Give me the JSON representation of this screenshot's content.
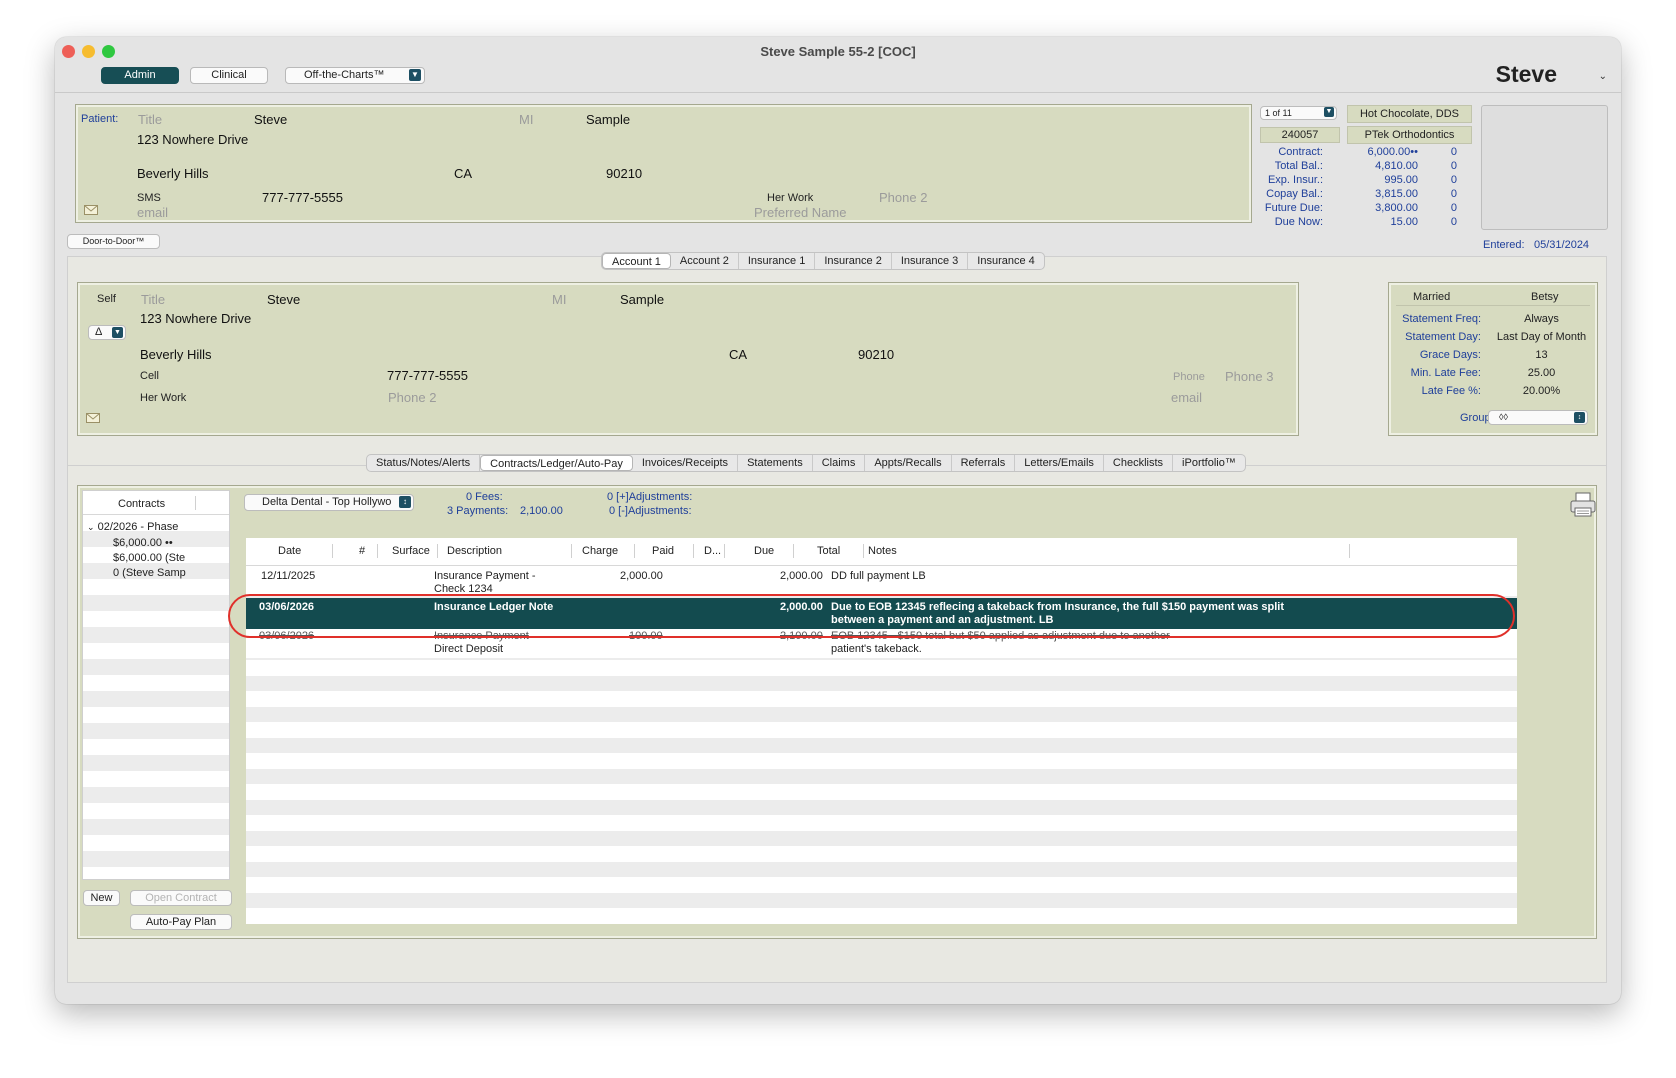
{
  "window": {
    "title": "Steve Sample 55-2 [COC]",
    "user_name": "Steve"
  },
  "toolbar": {
    "admin": "Admin",
    "clinical": "Clinical",
    "off_the_charts": "Off-the-Charts™"
  },
  "patient": {
    "label": "Patient:",
    "title_ph": "Title",
    "first": "Steve",
    "mi_ph": "MI",
    "last": "Sample",
    "address": "123 Nowhere Drive",
    "city": "Beverly Hills",
    "state": "CA",
    "zip": "90210",
    "sms_label": "SMS",
    "sms": "777-777-5555",
    "email_ph": "email",
    "work_label": "Her Work",
    "phone2_ph": "Phone 2",
    "preferred_ph": "Preferred Name",
    "door_button": "Door-to-Door™"
  },
  "summary": {
    "record_nav": "1 of 11",
    "doctor": "Hot Chocolate, DDS",
    "account_no": "240057",
    "practice": "PTek Orthodontics",
    "rows": [
      {
        "label": "Contract:",
        "value": "6,000.00••",
        "count": "0"
      },
      {
        "label": "Total Bal.:",
        "value": "4,810.00",
        "count": "0"
      },
      {
        "label": "Exp. Insur.:",
        "value": "995.00",
        "count": "0"
      },
      {
        "label": "Copay Bal.:",
        "value": "3,815.00",
        "count": "0"
      },
      {
        "label": "Future Due:",
        "value": "3,800.00",
        "count": "0"
      },
      {
        "label": "Due Now:",
        "value": "15.00",
        "count": "0"
      }
    ],
    "entered_label": "Entered:",
    "entered": "05/31/2024"
  },
  "account_tabs": [
    "Account 1",
    "Account 2",
    "Insurance 1",
    "Insurance 2",
    "Insurance 3",
    "Insurance 4"
  ],
  "account": {
    "relation": "Self",
    "title_ph": "Title",
    "first": "Steve",
    "mi_ph": "MI",
    "last": "Sample",
    "address": "123 Nowhere Drive",
    "delta": "Δ",
    "city": "Beverly Hills",
    "state": "CA",
    "zip": "90210",
    "cell_label": "Cell",
    "cell": "777-777-5555",
    "phone_label": "Phone",
    "phone3_ph": "Phone 3",
    "work_label": "Her Work",
    "phone2_ph": "Phone 2",
    "email_ph": "email"
  },
  "billing": {
    "status": "Married",
    "spouse": "Betsy",
    "rows": [
      {
        "label": "Statement Freq:",
        "value": "Always"
      },
      {
        "label": "Statement Day:",
        "value": "Last Day of Month"
      },
      {
        "label": "Grace Days:",
        "value": "13"
      },
      {
        "label": "Min. Late Fee:",
        "value": "25.00"
      },
      {
        "label": "Late Fee %:",
        "value": "20.00%"
      }
    ],
    "group_label": "Group:",
    "group_value": "◊◊"
  },
  "main_tabs": [
    "Status/Notes/Alerts",
    "Contracts/Ledger/Auto-Pay",
    "Invoices/Receipts",
    "Statements",
    "Claims",
    "Appts/Recalls",
    "Referrals",
    "Letters/Emails",
    "Checklists",
    "iPortfolio™"
  ],
  "contracts": {
    "header": "Contracts",
    "phase": "02/2026 - Phase",
    "items": [
      "$6,000.00 ••",
      "$6,000.00 (Ste",
      "0 (Steve Samp"
    ],
    "new_button": "New",
    "open_button": "Open Contract",
    "autopay_button": "Auto-Pay Plan"
  },
  "ledger": {
    "insurance_select": "Delta Dental - Top Hollywo",
    "fees": "0 Fees:",
    "payments": "3 Payments:",
    "payments_total": "2,100.00",
    "adj_plus": "0 [+]Adjustments:",
    "adj_minus": "0 [-]Adjustments:",
    "columns": [
      "Date",
      "#",
      "Surface",
      "Description",
      "Charge",
      "Paid",
      "D...",
      "Due",
      "Total",
      "Notes"
    ],
    "rows": [
      {
        "date": "12/11/2025",
        "desc1": "Insurance Payment -",
        "desc2": "Check 1234",
        "paid": "2,000.00",
        "total": "2,000.00",
        "note1": "DD full payment LB",
        "note2": ""
      },
      {
        "date": "03/06/2026",
        "desc1": "Insurance Ledger Note",
        "desc2": "",
        "paid": "",
        "total": "2,000.00",
        "note1": "Due to EOB 12345 reflecing a takeback from Insurance, the full $150 payment was split",
        "note2": "between a payment and an adjustment. LB"
      },
      {
        "date": "03/06/2026",
        "desc1": "Insurance Payment",
        "desc2": "Direct Deposit",
        "paid": "100.00",
        "total": "2,100.00",
        "note1": "EOB 12345 - $150 total but $50 applied as adjustment due to another",
        "note2": "patient's takeback."
      }
    ]
  },
  "colors": {
    "accent_dark_teal": "#134b4f",
    "panel_olive": "#d7dbc0",
    "highlight_red": "#e0302a",
    "label_blue": "#1f3f9a"
  }
}
